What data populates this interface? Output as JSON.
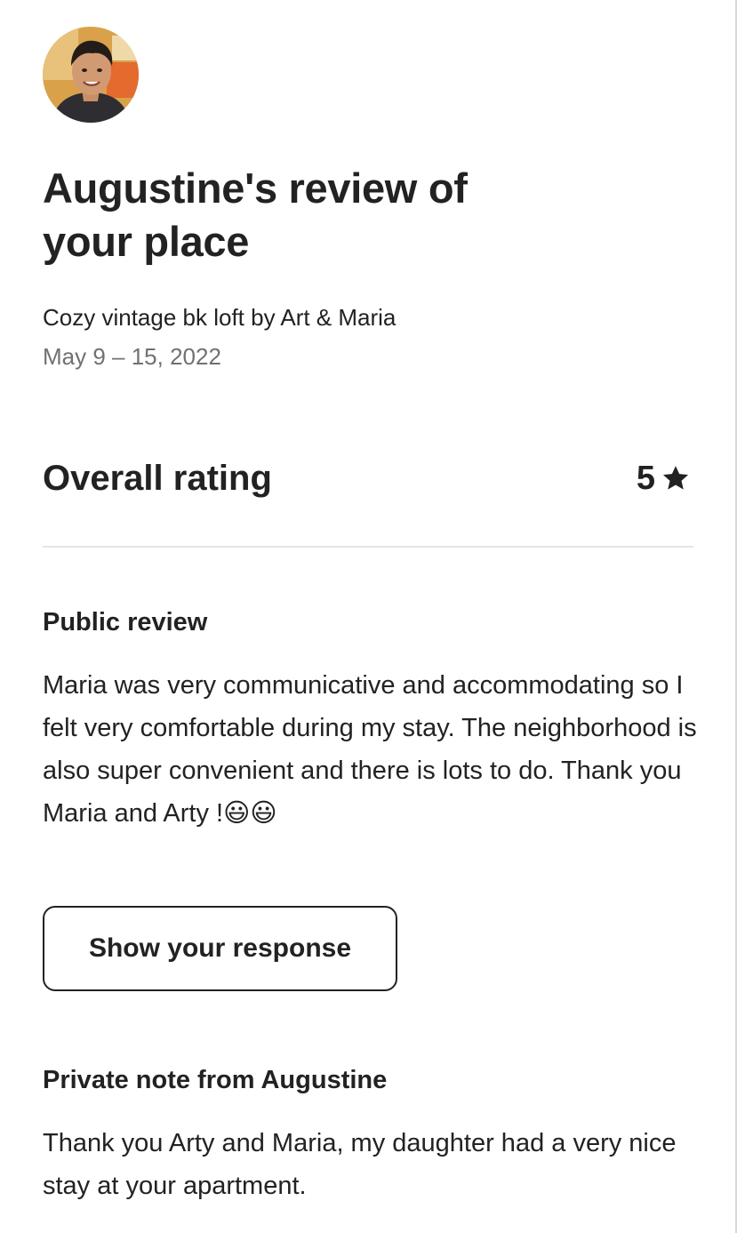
{
  "header": {
    "title_line1": "Augustine's review of",
    "title_line2": "your place"
  },
  "listing": {
    "name": "Cozy vintage bk loft by Art & Maria",
    "dates": "May 9 – 15, 2022"
  },
  "rating": {
    "label": "Overall rating",
    "value": "5",
    "icon": "star-icon"
  },
  "public_review": {
    "heading": "Public review",
    "text": "Maria was very communicative and accommodating so I felt very comfortable during my stay. The neighborhood is also super convenient and there is lots to do. Thank you Maria and Arty !😃😃",
    "button_label": "Show your response"
  },
  "private_note": {
    "heading": "Private note from Augustine",
    "text": "Thank you Arty and Maria, my daughter had a very nice stay at your apartment."
  },
  "colors": {
    "text": "#222222",
    "secondary_text": "#717171",
    "divider": "#e4e4e4"
  }
}
